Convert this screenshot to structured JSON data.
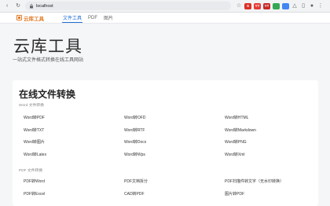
{
  "browser": {
    "url": "localhost",
    "extensions": [
      {
        "name": "red-extension-icon",
        "color": "#d93025",
        "label": "S"
      },
      {
        "name": "red-extension-icon-2",
        "color": "#e53935",
        "label": "YT"
      },
      {
        "name": "red-extension-icon-3",
        "color": "#c62828",
        "label": "YT"
      },
      {
        "name": "green-extension-icon",
        "color": "#34a853",
        "label": ""
      },
      {
        "name": "blue-extension-icon",
        "color": "#4285f4",
        "label": ""
      }
    ]
  },
  "site": {
    "logo_text": "云库工具",
    "tabs": [
      {
        "label": "文件工具",
        "active": true
      },
      {
        "label": "PDF",
        "active": false
      },
      {
        "label": "图片",
        "active": false
      }
    ]
  },
  "hero": {
    "title": "云库工具",
    "subtitle": "一站式文件格式转换在线工具网站"
  },
  "card": {
    "title": "在线文件转换",
    "groups": [
      {
        "label": "Word 文件转换",
        "items": [
          "Word转PDF",
          "Word转OFD",
          "Word转HTML",
          "Word转TXT",
          "Word转RTF",
          "Word转Markdown",
          "Word转图片",
          "Word转Docx",
          "Word转PNG",
          "Word转Latex",
          "Word转Wps",
          "Word转Xml"
        ]
      },
      {
        "label": "PDF 文件转换",
        "items": [
          "PDF转Word",
          "PDF文档拆分",
          "PDF扫描件转文字（无水印转换）",
          "PDF转Excel",
          "CAD转PDF",
          "图片转PDF"
        ]
      }
    ]
  },
  "colors": {
    "accent": "#1f6fd8",
    "logo": "#e07b28"
  }
}
